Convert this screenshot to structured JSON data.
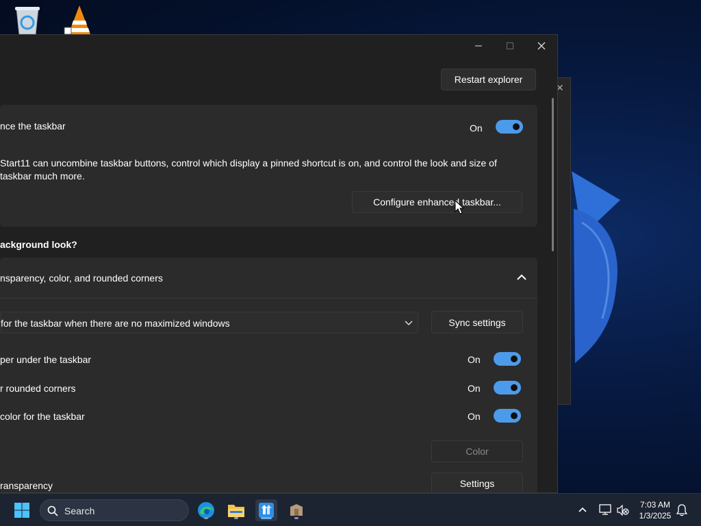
{
  "window": {
    "restart_label": "Restart explorer",
    "enhance": {
      "title": "nce the taskbar",
      "state": "On",
      "description": "Start11 can uncombine taskbar buttons, control which display a pinned shortcut is on, and control the look and size of taskbar much more.",
      "configure_label": "Configure enhanced taskbar..."
    },
    "background_heading": "ackground look?",
    "section": {
      "title": "nsparency, color, and rounded corners",
      "dropdown_value": "for the taskbar when there are no maximized windows",
      "sync_label": "Sync settings",
      "rows": [
        {
          "label": "per under the taskbar",
          "state": "On"
        },
        {
          "label": "r rounded corners",
          "state": "On"
        },
        {
          "label": "color for the taskbar",
          "state": "On"
        }
      ],
      "color_label": "Color",
      "transparency_label": "ransparency",
      "settings_label": "Settings"
    }
  },
  "taskbar": {
    "search_label": "Search",
    "time": "7:03 AM",
    "date": "1/3/2025"
  },
  "colors": {
    "accent": "#4c9bea",
    "window_bg": "#202020",
    "card_bg": "#2b2b2b"
  }
}
